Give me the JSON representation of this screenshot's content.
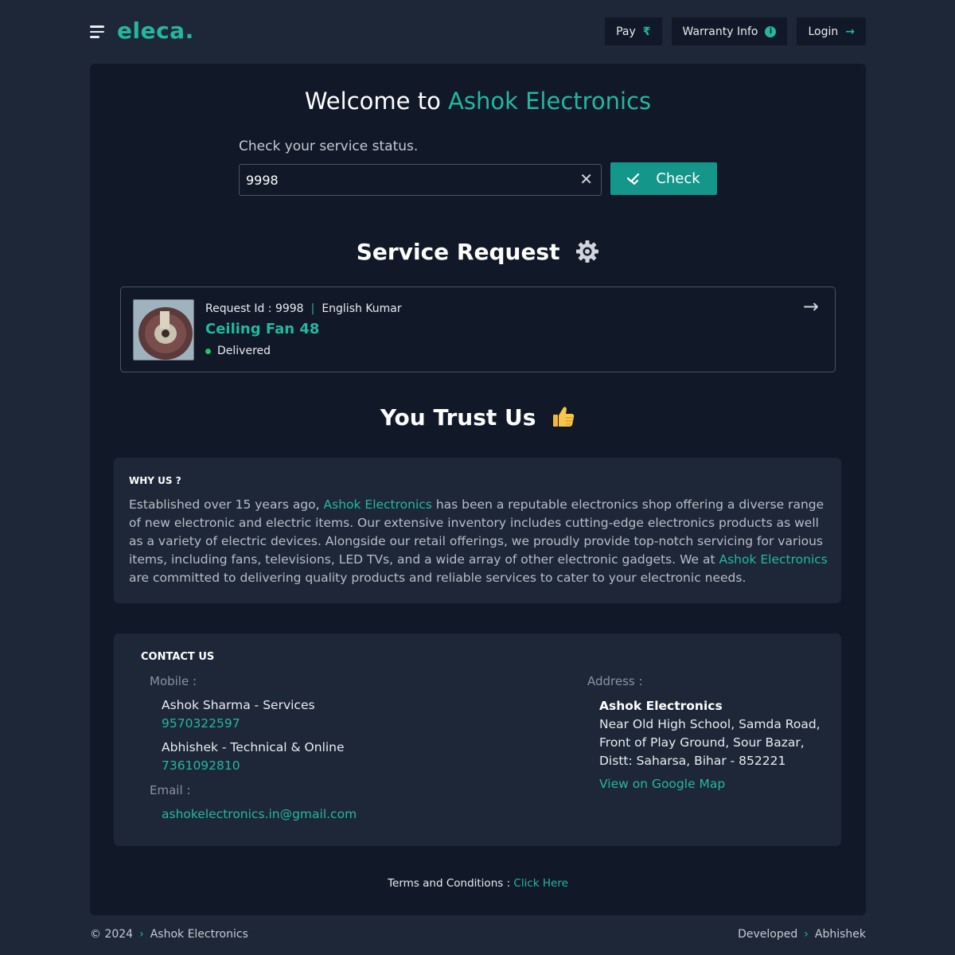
{
  "header": {
    "logo": "eleca",
    "logo_dot": ".",
    "nav": [
      {
        "label": "Pay",
        "icon": "₹"
      },
      {
        "label": "Warranty Info",
        "icon": "i"
      },
      {
        "label": "Login",
        "icon": "→"
      }
    ]
  },
  "welcome": {
    "prefix": "Welcome to",
    "brand": "Ashok Electronics"
  },
  "status_check": {
    "label": "Check your service status.",
    "input_value": "9998",
    "button_label": "Check"
  },
  "service_request": {
    "title": "Service Request",
    "request_id_label": "Request Id : 9998",
    "customer": "English Kumar",
    "product": "Ceiling Fan 48",
    "status": "Delivered"
  },
  "trust": {
    "title": "You Trust Us",
    "heading": "WHY US ?",
    "p1": "Established over 15 years ago,",
    "brand": "Ashok Electronics",
    "p2": "has been a reputable electronics shop offering a diverse range of new electronic and electric items. Our extensive inventory includes cutting-edge electronics products as well as a variety of electric devices. Alongside our retail offerings, we proudly provide top-notch servicing for various items, including fans, televisions, LED TVs, and a wide array of other electronic gadgets. We at",
    "p3": "are committed to delivering quality products and reliable services to cater to your electronic needs."
  },
  "contact": {
    "heading": "CONTACT US",
    "mobile_label": "Mobile :",
    "people": [
      {
        "name": "Ashok Sharma - Services",
        "phone": "9570322597"
      },
      {
        "name": "Abhishek - Technical & Online",
        "phone": "7361092810"
      }
    ],
    "email_label": "Email :",
    "email": "ashokelectronics.in@gmail.com",
    "address_label": "Address :",
    "address_name": "Ashok Electronics",
    "address_lines": [
      "Near Old High School, Samda Road,",
      "Front of Play Ground, Sour Bazar,",
      "Distt: Saharsa, Bihar - 852221"
    ],
    "map_link": "View on Google Map"
  },
  "terms": {
    "label": "Terms and Conditions :",
    "link": "Click Here"
  },
  "footer": {
    "year": "© 2024",
    "company": "Ashok Electronics",
    "developed": "Developed",
    "developer": "Abhishek"
  },
  "colors": {
    "accent": "#22b8a0",
    "button": "#14968a",
    "background": "#1e2737",
    "panel": "#111827",
    "status_dot": "#22c55e"
  }
}
